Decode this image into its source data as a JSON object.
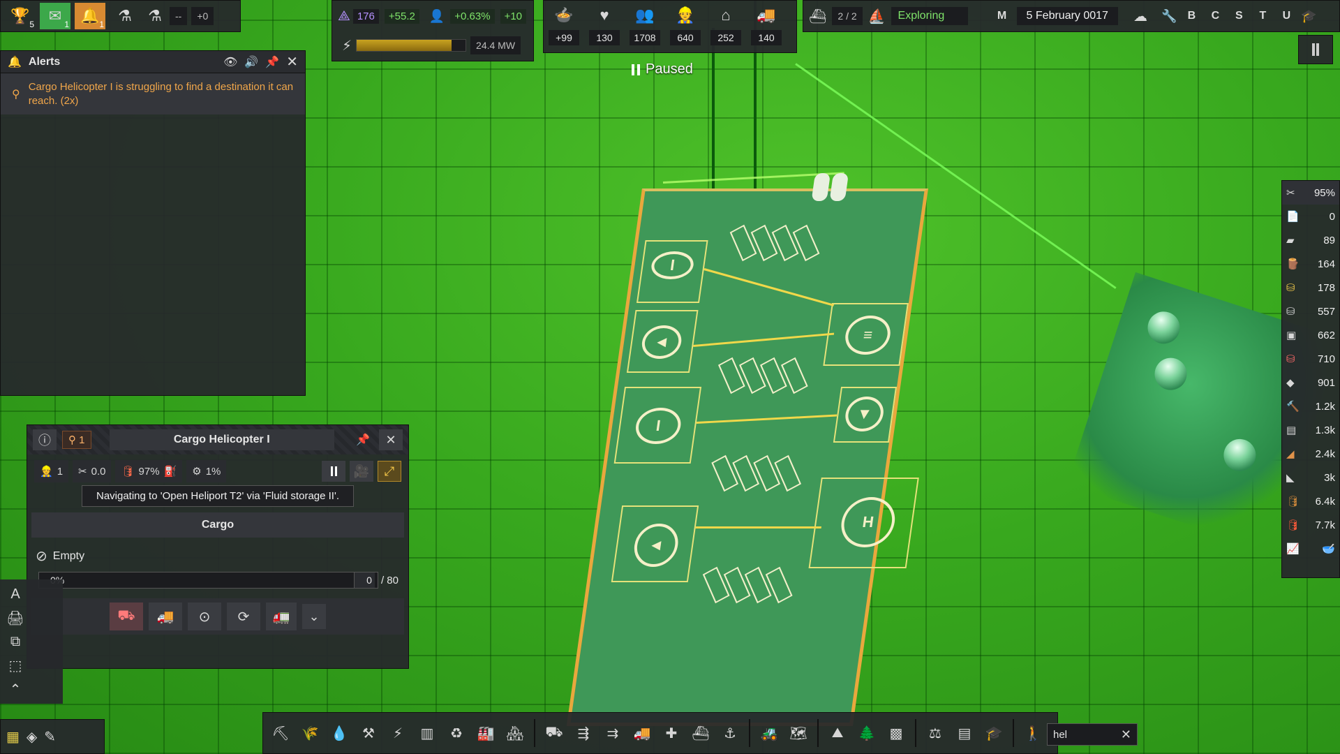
{
  "topbar": {
    "trophy_count": "5",
    "mail_count": "1",
    "alert_count": "1",
    "research_field": "--",
    "research_delta": "+0",
    "unity_value": "176",
    "unity_delta": "+55.2",
    "population_growth": "+0.63%",
    "population_delta": "+10",
    "power_value": "24.4 MW",
    "power_fill_ratio": 0.87,
    "stats": [
      {
        "icon": "food-icon",
        "value": "+99"
      },
      {
        "icon": "health-icon",
        "value": "130"
      },
      {
        "icon": "population-icon",
        "value": "1708"
      },
      {
        "icon": "workers-icon",
        "value": "640"
      },
      {
        "icon": "housing-icon",
        "value": "252"
      },
      {
        "icon": "vehicles-icon",
        "value": "140"
      }
    ],
    "ships_value": "2 / 2",
    "exploring_label": "Exploring",
    "m_label": "M",
    "date": "5 February 0017",
    "letters": [
      "B",
      "C",
      "S",
      "T",
      "U"
    ]
  },
  "paused_label": "Paused",
  "alerts": {
    "title": "Alerts",
    "items": [
      {
        "text": "Cargo Helicopter I is struggling to find a destination it can reach. (2x)"
      }
    ]
  },
  "vehicle_window": {
    "pin_count": "1",
    "title": "Cargo Helicopter I",
    "crew": "1",
    "maintenance": "0.0",
    "fuel": "97%",
    "progress": "1%",
    "navigation": "Navigating to 'Open Heliport T2' via 'Fluid storage II'.",
    "cargo_title": "Cargo",
    "cargo_status": "Empty",
    "cargo_percent": "0%",
    "cargo_amount": "0",
    "cargo_capacity": "/ 80"
  },
  "resources": {
    "maintenance_percent": "95%",
    "items": [
      {
        "icon": "paper-icon",
        "value": "0"
      },
      {
        "icon": "plates-icon",
        "value": "89"
      },
      {
        "icon": "wood-icon",
        "value": "164"
      },
      {
        "icon": "gold-icon",
        "value": "178"
      },
      {
        "icon": "silver-icon",
        "value": "557"
      },
      {
        "icon": "steel-icon",
        "value": "662"
      },
      {
        "icon": "fertilizer-icon",
        "value": "710"
      },
      {
        "icon": "rock-icon",
        "value": "901"
      },
      {
        "icon": "tools-icon",
        "value": "1.2k"
      },
      {
        "icon": "coal-icon",
        "value": "1.3k"
      },
      {
        "icon": "bread-icon",
        "value": "2.4k"
      },
      {
        "icon": "gravel-icon",
        "value": "3k"
      },
      {
        "icon": "barrel-icon",
        "value": "6.4k"
      },
      {
        "icon": "fuel-icon",
        "value": "7.7k"
      }
    ]
  },
  "search": {
    "value": "hel"
  },
  "colors": {
    "accent_green": "#7fe36a",
    "alert_orange": "#f0a64a",
    "panel_bg": "#26282c",
    "heliport_border": "#e9a83d"
  }
}
